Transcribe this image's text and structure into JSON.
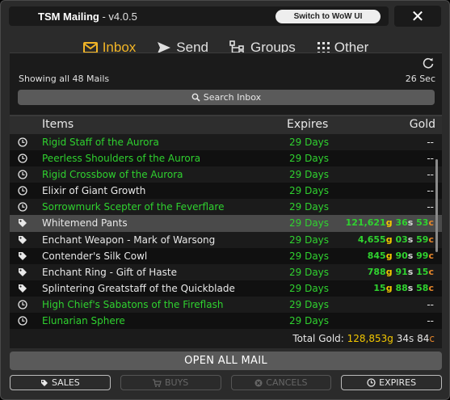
{
  "window": {
    "title": "TSM Mailing",
    "version": "- v4.0.5",
    "switch_label": "Switch to WoW UI",
    "close_glyph": "✕"
  },
  "tabs": [
    {
      "label": "Inbox",
      "icon": "envelope-icon",
      "active": true
    },
    {
      "label": "Send",
      "icon": "send-icon",
      "active": false
    },
    {
      "label": "Groups",
      "icon": "groups-icon",
      "active": false
    },
    {
      "label": "Other",
      "icon": "grid-dots-icon",
      "active": false
    }
  ],
  "inbox": {
    "showing": "Showing all 48 Mails",
    "timer": "26 Sec",
    "search_placeholder": "Search Inbox",
    "columns": {
      "items": "Items",
      "expires": "Expires",
      "gold": "Gold"
    },
    "rows": [
      {
        "icon": "clock-icon",
        "name": "Rigid Staff of the Aurora",
        "color": "green",
        "expires": "29 Days",
        "gold": "--"
      },
      {
        "icon": "clock-icon",
        "name": "Peerless Shoulders of the Aurora",
        "color": "green",
        "expires": "29 Days",
        "gold": "--"
      },
      {
        "icon": "clock-icon",
        "name": "Rigid Crossbow of the Aurora",
        "color": "green",
        "expires": "29 Days",
        "gold": "--"
      },
      {
        "icon": "clock-icon",
        "name": "Elixir of Giant Growth",
        "color": "white",
        "expires": "29 Days",
        "gold": "--"
      },
      {
        "icon": "clock-icon",
        "name": "Sorrowmurk Scepter of the Feverflare",
        "color": "green",
        "expires": "29 Days",
        "gold": "--"
      },
      {
        "icon": "tag-icon",
        "name": "Whitemend Pants",
        "color": "white",
        "expires": "29 Days",
        "selected": true,
        "g": "121,621",
        "s": "36",
        "c": "53"
      },
      {
        "icon": "tag-icon",
        "name": "Enchant Weapon - Mark of Warsong",
        "color": "white",
        "expires": "29 Days",
        "g": "4,655",
        "s": "03",
        "c": "59"
      },
      {
        "icon": "tag-icon",
        "name": "Contender's Silk Cowl",
        "color": "white",
        "expires": "29 Days",
        "g": "845",
        "s": "90",
        "c": "99"
      },
      {
        "icon": "tag-icon",
        "name": "Enchant Ring - Gift of Haste",
        "color": "white",
        "expires": "29 Days",
        "g": "788",
        "s": "91",
        "c": "15"
      },
      {
        "icon": "tag-icon",
        "name": "Splintering Greatstaff of the Quickblade",
        "color": "white",
        "expires": "29 Days",
        "g": "15",
        "s": "88",
        "c": "58"
      },
      {
        "icon": "clock-icon",
        "name": "High Chief's Sabatons of the Fireflash",
        "color": "green",
        "expires": "29 Days",
        "gold": "--"
      },
      {
        "icon": "clock-icon",
        "name": "Elunarian Sphere",
        "color": "green",
        "expires": "29 Days",
        "gold": "--"
      }
    ],
    "total_label": "Total Gold: ",
    "total": {
      "g": "128,853",
      "s": "34",
      "c": "84"
    }
  },
  "actions": {
    "open_all": "OPEN ALL MAIL",
    "sales": "SALES",
    "buys": "BUYS",
    "cancels": "CANCELS",
    "expires": "EXPIRES"
  },
  "colors": {
    "accent": "#f2b526",
    "green": "#2fd22f",
    "gold": "#f2c700",
    "copper": "#e6862a"
  }
}
